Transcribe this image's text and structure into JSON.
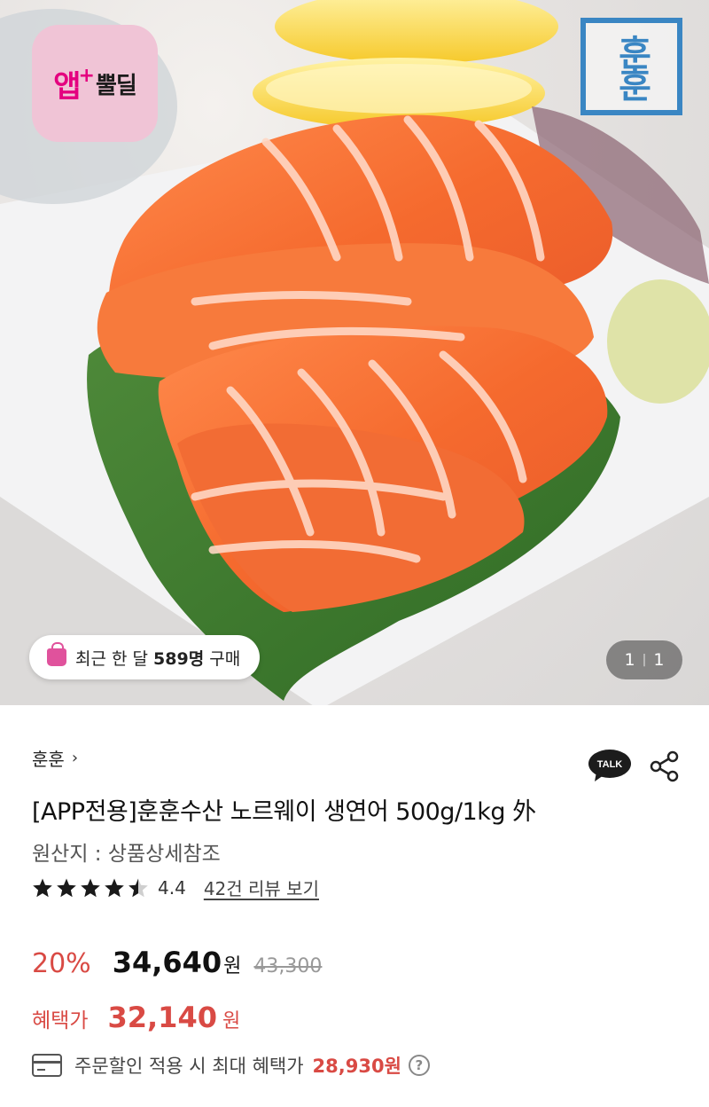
{
  "hero": {
    "app_badge": {
      "big": "앱",
      "plus": "+",
      "small": "뿔딜"
    },
    "brand_logo": "훈훈",
    "purchase_pill": {
      "prefix": "최근 한 달",
      "count": "589명",
      "suffix": "구매"
    },
    "page_indicator": {
      "current": "1",
      "separator": "|",
      "total": "1"
    }
  },
  "product": {
    "seller": "훈훈",
    "title": "[APP전용]훈훈수산 노르웨이 생연어 500g/1kg 外",
    "origin": "원산지 : 상품상세참조",
    "rating": {
      "value": 4.4,
      "label": "4.4",
      "review_link": "42건 리뷰 보기"
    },
    "talk_label": "TALK"
  },
  "pricing": {
    "discount": "20%",
    "price": "34,640",
    "won": "원",
    "original": "43,300",
    "benefit_label": "혜택가",
    "benefit_price": "32,140",
    "benefit_won": "원",
    "coupon_text": "주문할인 적용 시 최대 혜택가",
    "coupon_price": "28,930원",
    "help": "?"
  },
  "colors": {
    "accent_red": "#d94a44",
    "badge_pink": "#f0c4d6",
    "brand_blue": "#3a86c3"
  },
  "icons": [
    "shopping-bag-icon",
    "chevron-right-icon",
    "kakao-talk-icon",
    "share-icon",
    "star-icon",
    "credit-card-icon",
    "help-icon"
  ]
}
